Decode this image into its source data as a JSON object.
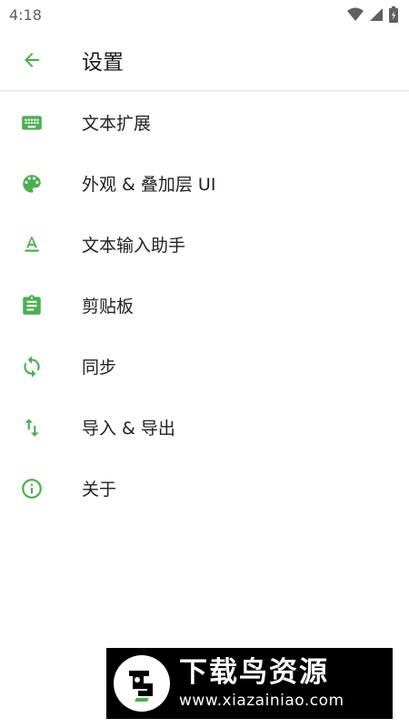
{
  "status_bar": {
    "time": "4:18",
    "icons": [
      "wifi-icon",
      "cell-signal-icon",
      "battery-icon"
    ]
  },
  "app_bar": {
    "back_icon": "arrow-left-icon",
    "title": "设置"
  },
  "menu": {
    "items": [
      {
        "label": "文本扩展",
        "icon": "keyboard-icon"
      },
      {
        "label": "外观 & 叠加层 UI",
        "icon": "palette-icon"
      },
      {
        "label": "文本输入助手",
        "icon": "text-format-icon"
      },
      {
        "label": "剪贴板",
        "icon": "clipboard-icon"
      },
      {
        "label": "同步",
        "icon": "sync-icon"
      },
      {
        "label": "导入 & 导出",
        "icon": "import-export-icon"
      },
      {
        "label": "关于",
        "icon": "info-icon"
      }
    ]
  },
  "watermark": {
    "name": "下载鸟资源",
    "url": "www.xiazainiao.com"
  },
  "colors": {
    "accent": "#4caf50",
    "text": "#222222",
    "status": "#606060"
  }
}
